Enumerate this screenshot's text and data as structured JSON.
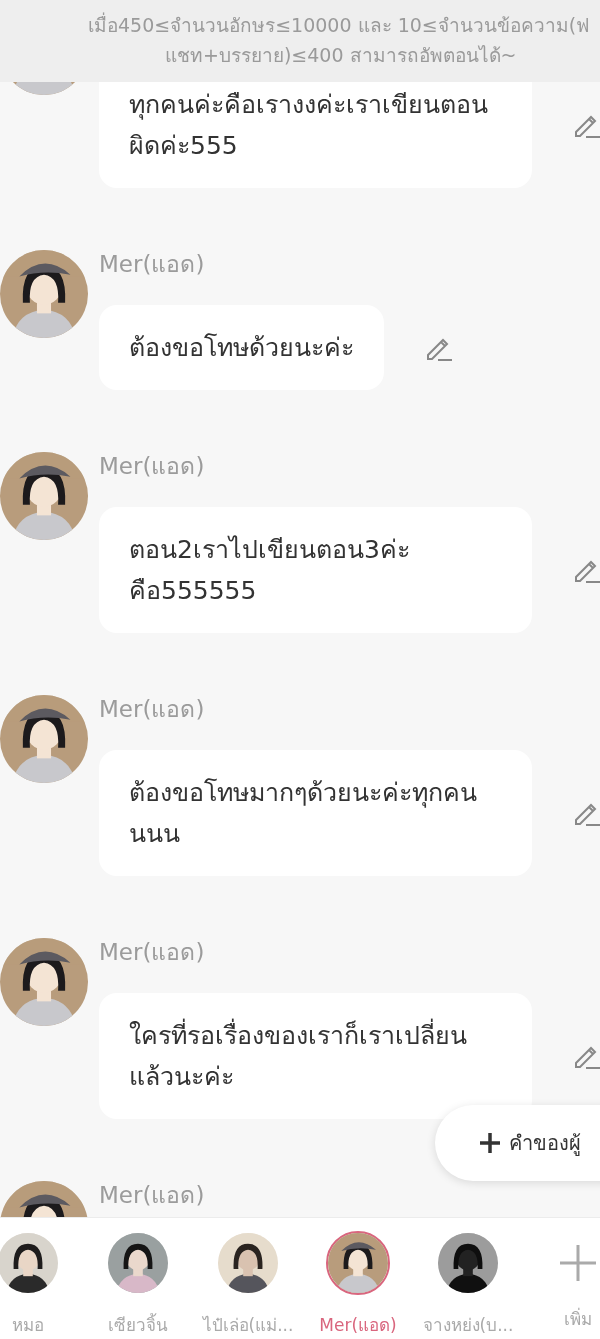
{
  "banner": {
    "lines": [
      "เมื่อ450≤จำนวนอักษร≤10000 และ 10≤จำนวนข้อความ(ฟ",
      "แชท+บรรยาย)≤400 สามารถอัพตอนได้~"
    ]
  },
  "messages": [
    {
      "text": "ทุกคนค่ะคือเรางงค่ะเราเขียนตอนผิดค่ะ555"
    },
    {
      "name": "Mer(แอด)",
      "text": "ต้องขอโทษด้วยนะค่ะ"
    },
    {
      "name": "Mer(แอด)",
      "text": "ตอน2เราไปเขียนตอน3ค่ะคือ555555"
    },
    {
      "name": "Mer(แอด)",
      "text": "ต้องขอโทษมากๆด้วยนะค่ะทุกคนนนน"
    },
    {
      "name": "Mer(แอด)",
      "text": "ใครที่รอเรื่องของเราก็เราเปลี่ยนแล้วนะค่ะ"
    },
    {
      "name": "Mer(แอด)"
    }
  ],
  "float_button": {
    "label": "คำของผู้"
  },
  "characters": [
    {
      "name": "หมอ",
      "selected": false
    },
    {
      "name": "เซียวจิ้น",
      "selected": false
    },
    {
      "name": "ไป๋เล่อ(แม่...",
      "selected": false
    },
    {
      "name": "Mer(แอด)",
      "selected": true
    },
    {
      "name": "จางหย่ง(บ...",
      "selected": false
    }
  ],
  "add": {
    "label": "เพิ่ม"
  }
}
